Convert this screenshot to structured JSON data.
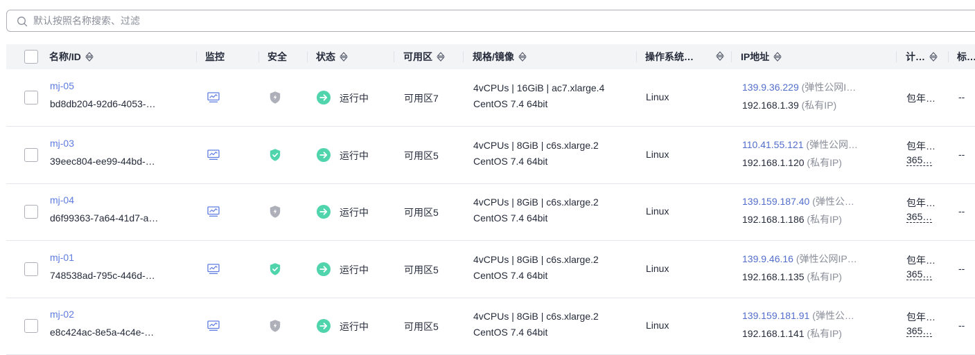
{
  "search": {
    "placeholder": "默认按照名称搜索、过滤"
  },
  "columns": {
    "name": "名称/ID",
    "monitor": "监控",
    "security": "安全",
    "status": "状态",
    "zone": "可用区",
    "spec": "规格/镜像",
    "os": "操作系统…",
    "ip": "IP地址",
    "billing": "计…",
    "tag": "标…"
  },
  "rows": [
    {
      "name": "mj-05",
      "id": "bd8db204-92d6-4053-…",
      "security": "gray",
      "status": "运行中",
      "zone": "可用区7",
      "spec": "4vCPUs | 16GiB | ac7.xlarge.4",
      "image": "CentOS 7.4 64bit",
      "os": "Linux",
      "eip": "139.9.36.229",
      "eip_label": "(弹性公网I…",
      "private_ip": "192.168.1.39",
      "private_label": "(私有IP)",
      "billing": "包年…",
      "billing_sub": "",
      "tag": "--"
    },
    {
      "name": "mj-03",
      "id": "39eec804-ee99-44bd-…",
      "security": "green",
      "status": "运行中",
      "zone": "可用区5",
      "spec": "4vCPUs | 8GiB | c6s.xlarge.2",
      "image": "CentOS 7.4 64bit",
      "os": "Linux",
      "eip": "110.41.55.121",
      "eip_label": "(弹性公网…",
      "private_ip": "192.168.1.120",
      "private_label": "(私有IP)",
      "billing": "包年…",
      "billing_sub": "365…",
      "tag": "--"
    },
    {
      "name": "mj-04",
      "id": "d6f99363-7a64-41d7-a…",
      "security": "gray",
      "status": "运行中",
      "zone": "可用区5",
      "spec": "4vCPUs | 8GiB | c6s.xlarge.2",
      "image": "CentOS 7.4 64bit",
      "os": "Linux",
      "eip": "139.159.187.40",
      "eip_label": "(弹性公…",
      "private_ip": "192.168.1.186",
      "private_label": "(私有IP)",
      "billing": "包年…",
      "billing_sub": "365…",
      "tag": "--"
    },
    {
      "name": "mj-01",
      "id": "748538ad-795c-446d-…",
      "security": "green",
      "status": "运行中",
      "zone": "可用区5",
      "spec": "4vCPUs | 8GiB | c6s.xlarge.2",
      "image": "CentOS 7.4 64bit",
      "os": "Linux",
      "eip": "139.9.46.16",
      "eip_label": "(弹性公网IP…",
      "private_ip": "192.168.1.135",
      "private_label": "(私有IP)",
      "billing": "包年…",
      "billing_sub": "365…",
      "tag": "--"
    },
    {
      "name": "mj-02",
      "id": "e8c424ac-8e5a-4c4e-…",
      "security": "gray",
      "status": "运行中",
      "zone": "可用区5",
      "spec": "4vCPUs | 8GiB | c6s.xlarge.2",
      "image": "CentOS 7.4 64bit",
      "os": "Linux",
      "eip": "139.159.181.91",
      "eip_label": "(弹性公…",
      "private_ip": "192.168.1.141",
      "private_label": "(私有IP)",
      "billing": "包年…",
      "billing_sub": "365…",
      "tag": "--"
    }
  ],
  "colors": {
    "link": "#5e7ce0",
    "running": "#50d4ab",
    "shield_gray": "#adb0b8",
    "shield_green": "#50d4ab",
    "header_bg": "#f3f4f6"
  },
  "icons": {
    "search": "search-icon",
    "sort": "sort-icon",
    "monitor": "monitor-chart-icon",
    "security": "shield-icon",
    "status": "running-arrow-icon"
  }
}
